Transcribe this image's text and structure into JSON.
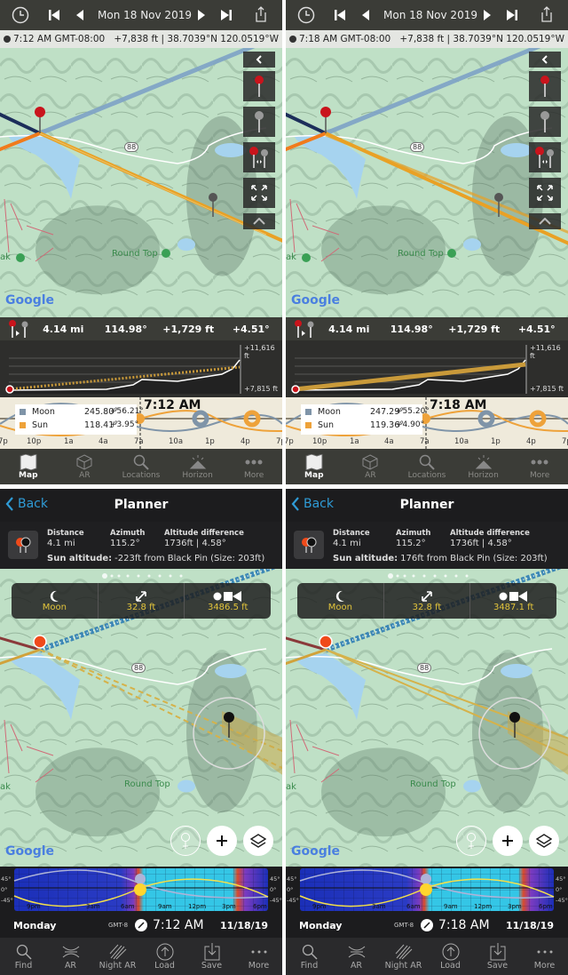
{
  "top_shared": {
    "elev_max": "+11,616 ft",
    "elev_min": "+7,815 ft",
    "time_ticks": [
      "7p",
      "10p",
      "1a",
      "4a",
      "7a",
      "10a",
      "1p",
      "4p",
      "7p"
    ],
    "tabs": [
      {
        "label": "Map",
        "icon": "map-icon",
        "active": true
      },
      {
        "label": "AR",
        "icon": "ar-cube-icon",
        "active": false
      },
      {
        "label": "Locations",
        "icon": "search-icon",
        "active": false
      },
      {
        "label": "Horizon",
        "icon": "horizon-icon",
        "active": false
      },
      {
        "label": "More",
        "icon": "more-dots-icon",
        "active": false
      }
    ],
    "map_labels": {
      "road": "88",
      "peak": "Round Top",
      "peak_partial": "ak",
      "attribution": "Google"
    },
    "colors": {
      "sun": "#f0a322",
      "moon": "#7f9ab5",
      "header": "#3b3c37"
    }
  },
  "top_panels": [
    {
      "date": "Mon 18 Nov 2019",
      "time_zone": "7:12 AM GMT-08:00",
      "location": "+7,838 ft | 38.7039°N 120.0519°W",
      "stats": {
        "distance": "4.14 mi",
        "azimuth": "114.98°",
        "elevation": "+1,729 ft",
        "angle": "+4.51°"
      },
      "timeline_time": "7:12 AM",
      "moon": {
        "label": "Moon",
        "azimuth": "245.80°",
        "altitude": "+56.21°"
      },
      "sun": {
        "label": "Sun",
        "azimuth": "118.41°",
        "altitude": "+3.95°"
      }
    },
    {
      "date": "Mon 18 Nov 2019",
      "time_zone": "7:18 AM GMT-08:00",
      "location": "+7,838 ft | 38.7039°N 120.0519°W",
      "stats": {
        "distance": "4.14 mi",
        "azimuth": "114.98°",
        "elevation": "+1,729 ft",
        "angle": "+4.51°"
      },
      "timeline_time": "7:18 AM",
      "moon": {
        "label": "Moon",
        "azimuth": "247.29°",
        "altitude": "+55.20°"
      },
      "sun": {
        "label": "Sun",
        "azimuth": "119.36°",
        "altitude": "+4.90°"
      }
    }
  ],
  "bottom_shared": {
    "back": "Back",
    "title": "Planner",
    "labels": {
      "distance": "Distance",
      "azimuth": "Azimuth",
      "alt_diff": "Altitude difference",
      "sun_alt": "Sun altitude:"
    },
    "sunbar_ticks": [
      "9pm",
      "3am",
      "6am",
      "9am",
      "12pm",
      "3pm",
      "6pm"
    ],
    "sunbar_deg": [
      "45°",
      "0°",
      "-45°"
    ],
    "day": "Monday",
    "gmt": "GMT-8",
    "date": "11/18/19",
    "mode": {
      "label": "Moon",
      "lens": "32.8 ft"
    },
    "tools": [
      {
        "label": "Find",
        "icon": "search-icon"
      },
      {
        "label": "AR",
        "icon": "ar-icon"
      },
      {
        "label": "Night AR",
        "icon": "night-ar-icon"
      },
      {
        "label": "Load",
        "icon": "load-upload-icon"
      },
      {
        "label": "Save",
        "icon": "save-download-icon"
      },
      {
        "label": "More",
        "icon": "more-dots-icon"
      }
    ],
    "map_labels": {
      "road": "88",
      "peak": "Round Top",
      "peak_partial": "ak",
      "attribution": "Google"
    },
    "colors": {
      "accent": "#2f9bd6",
      "mode_text": "#e3c53b"
    }
  },
  "bottom_panels": [
    {
      "distance": "4.1 mi",
      "azimuth": "115.2°",
      "alt_diff": "1736ft | 4.58°",
      "sun_alt": "-223ft from Black Pin (Size: 203ft)",
      "distance_to_subject": "3486.5 ft",
      "time": "7:12 AM"
    },
    {
      "distance": "4.1 mi",
      "azimuth": "115.2°",
      "alt_diff": "1736ft | 4.58°",
      "sun_alt": "176ft from Black Pin (Size: 203ft)",
      "distance_to_subject": "3487.1 ft",
      "time": "7:18 AM"
    }
  ]
}
